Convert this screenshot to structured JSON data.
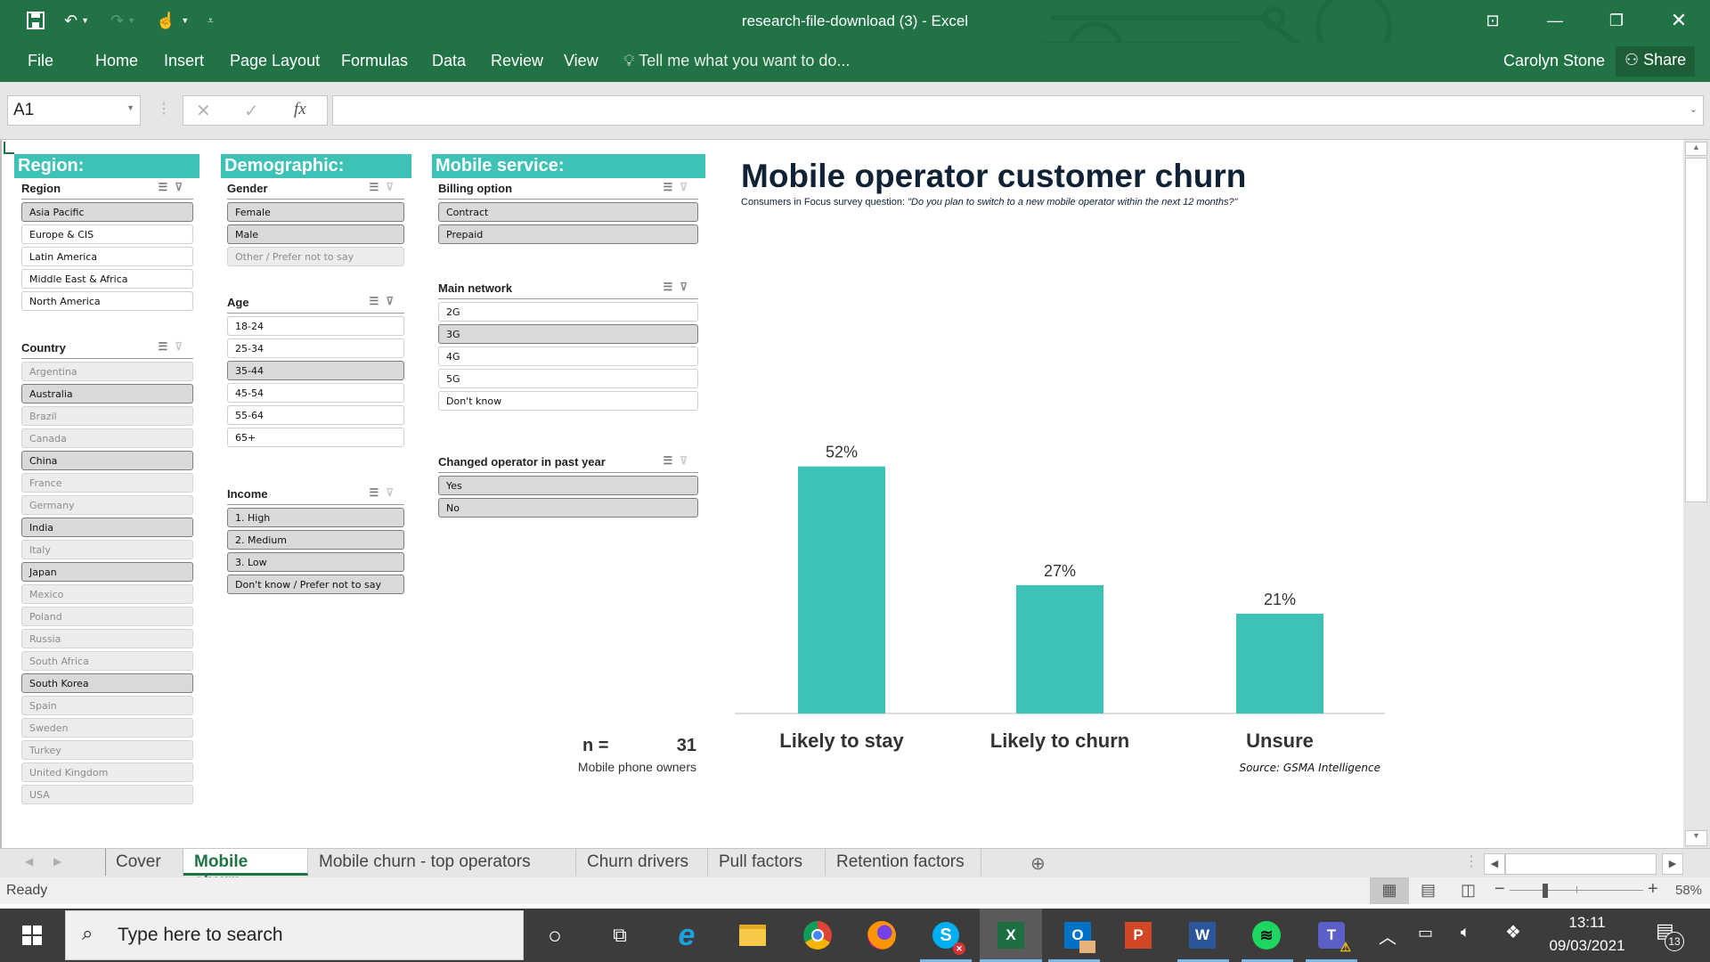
{
  "window": {
    "title": "research-file-download (3) - Excel",
    "user": "Carolyn Stone",
    "share_label": "Share"
  },
  "ribbon": {
    "tabs": [
      "File",
      "Home",
      "Insert",
      "Page Layout",
      "Formulas",
      "Data",
      "Review",
      "View"
    ],
    "tell_me": "Tell me what you want to do..."
  },
  "formula_bar": {
    "name_box": "A1",
    "formula": "",
    "fx_label": "fx"
  },
  "slicer_groups": {
    "region": "Region:",
    "demographic": "Demographic:",
    "mobile_service": "Mobile service:"
  },
  "slicers": {
    "region": {
      "title": "Region",
      "items": [
        {
          "label": "Asia Pacific",
          "state": "sel"
        },
        {
          "label": "Europe & CIS",
          "state": "unsel"
        },
        {
          "label": "Latin America",
          "state": "unsel"
        },
        {
          "label": "Middle East & Africa",
          "state": "unsel"
        },
        {
          "label": "North America",
          "state": "unsel"
        }
      ]
    },
    "country": {
      "title": "Country",
      "items": [
        {
          "label": "Argentina",
          "state": "nodata"
        },
        {
          "label": "Australia",
          "state": "sel"
        },
        {
          "label": "Brazil",
          "state": "nodata"
        },
        {
          "label": "Canada",
          "state": "nodata"
        },
        {
          "label": "China",
          "state": "sel"
        },
        {
          "label": "France",
          "state": "nodata"
        },
        {
          "label": "Germany",
          "state": "nodata"
        },
        {
          "label": "India",
          "state": "sel"
        },
        {
          "label": "Italy",
          "state": "nodata"
        },
        {
          "label": "Japan",
          "state": "sel"
        },
        {
          "label": "Mexico",
          "state": "nodata"
        },
        {
          "label": "Poland",
          "state": "nodata"
        },
        {
          "label": "Russia",
          "state": "nodata"
        },
        {
          "label": "South Africa",
          "state": "nodata"
        },
        {
          "label": "South Korea",
          "state": "sel"
        },
        {
          "label": "Spain",
          "state": "nodata"
        },
        {
          "label": "Sweden",
          "state": "nodata"
        },
        {
          "label": "Turkey",
          "state": "nodata"
        },
        {
          "label": "United Kingdom",
          "state": "nodata"
        },
        {
          "label": "USA",
          "state": "nodata"
        }
      ]
    },
    "gender": {
      "title": "Gender",
      "items": [
        {
          "label": "Female",
          "state": "sel"
        },
        {
          "label": "Male",
          "state": "sel"
        },
        {
          "label": "Other / Prefer not to say",
          "state": "nodata"
        }
      ]
    },
    "age": {
      "title": "Age",
      "items": [
        {
          "label": "18-24",
          "state": "unsel"
        },
        {
          "label": "25-34",
          "state": "unsel"
        },
        {
          "label": "35-44",
          "state": "sel"
        },
        {
          "label": "45-54",
          "state": "unsel"
        },
        {
          "label": "55-64",
          "state": "unsel"
        },
        {
          "label": "65+",
          "state": "unsel"
        }
      ]
    },
    "income": {
      "title": "Income",
      "items": [
        {
          "label": "1. High",
          "state": "sel"
        },
        {
          "label": "2. Medium",
          "state": "sel"
        },
        {
          "label": "3. Low",
          "state": "sel"
        },
        {
          "label": "Don't know / Prefer not to say",
          "state": "sel"
        }
      ]
    },
    "billing": {
      "title": "Billing option",
      "items": [
        {
          "label": "Contract",
          "state": "sel"
        },
        {
          "label": "Prepaid",
          "state": "sel"
        }
      ]
    },
    "network": {
      "title": "Main network",
      "items": [
        {
          "label": "2G",
          "state": "unsel"
        },
        {
          "label": "3G",
          "state": "sel"
        },
        {
          "label": "4G",
          "state": "unsel"
        },
        {
          "label": "5G",
          "state": "unsel"
        },
        {
          "label": "Don't know",
          "state": "unsel"
        }
      ]
    },
    "changed": {
      "title": "Changed operator in past year",
      "items": [
        {
          "label": "Yes",
          "state": "sel"
        },
        {
          "label": "No",
          "state": "sel"
        }
      ]
    }
  },
  "sample": {
    "n_label": "n =",
    "n_value": "31",
    "caption": "Mobile phone owners"
  },
  "chart_data": {
    "type": "bar",
    "title": "Mobile operator customer churn",
    "subtitle_prefix": "Consumers in Focus survey question:",
    "subtitle_question": "\"Do you plan to switch to a new mobile operator within the next 12 months?\"",
    "categories": [
      "Likely to stay",
      "Likely to churn",
      "Unsure"
    ],
    "values": [
      52,
      27,
      21
    ],
    "value_labels": [
      "52%",
      "27%",
      "21%"
    ],
    "unit": "%",
    "ylim": [
      0,
      60
    ],
    "grid": false,
    "legend": "none",
    "bar_color": "#3ec2b6",
    "source": "Source: GSMA Intelligence"
  },
  "sheet_tabs": {
    "tabs": [
      "Cover",
      "Mobile churn",
      "Mobile churn - top operators",
      "Churn drivers",
      "Pull factors",
      "Retention factors"
    ],
    "active": "Mobile churn"
  },
  "status": {
    "text": "Ready",
    "zoom": "58%",
    "zoom_fraction": 0.58
  },
  "taskbar": {
    "search_placeholder": "Type here to search",
    "time": "13:11",
    "date": "09/03/2021",
    "notification_count": "13",
    "apps": [
      "Cortana",
      "Task View",
      "Internet Explorer",
      "File Explorer",
      "Chrome",
      "Firefox",
      "Skype",
      "Excel",
      "Outlook",
      "PowerPoint",
      "Word",
      "Spotify",
      "Teams"
    ]
  }
}
